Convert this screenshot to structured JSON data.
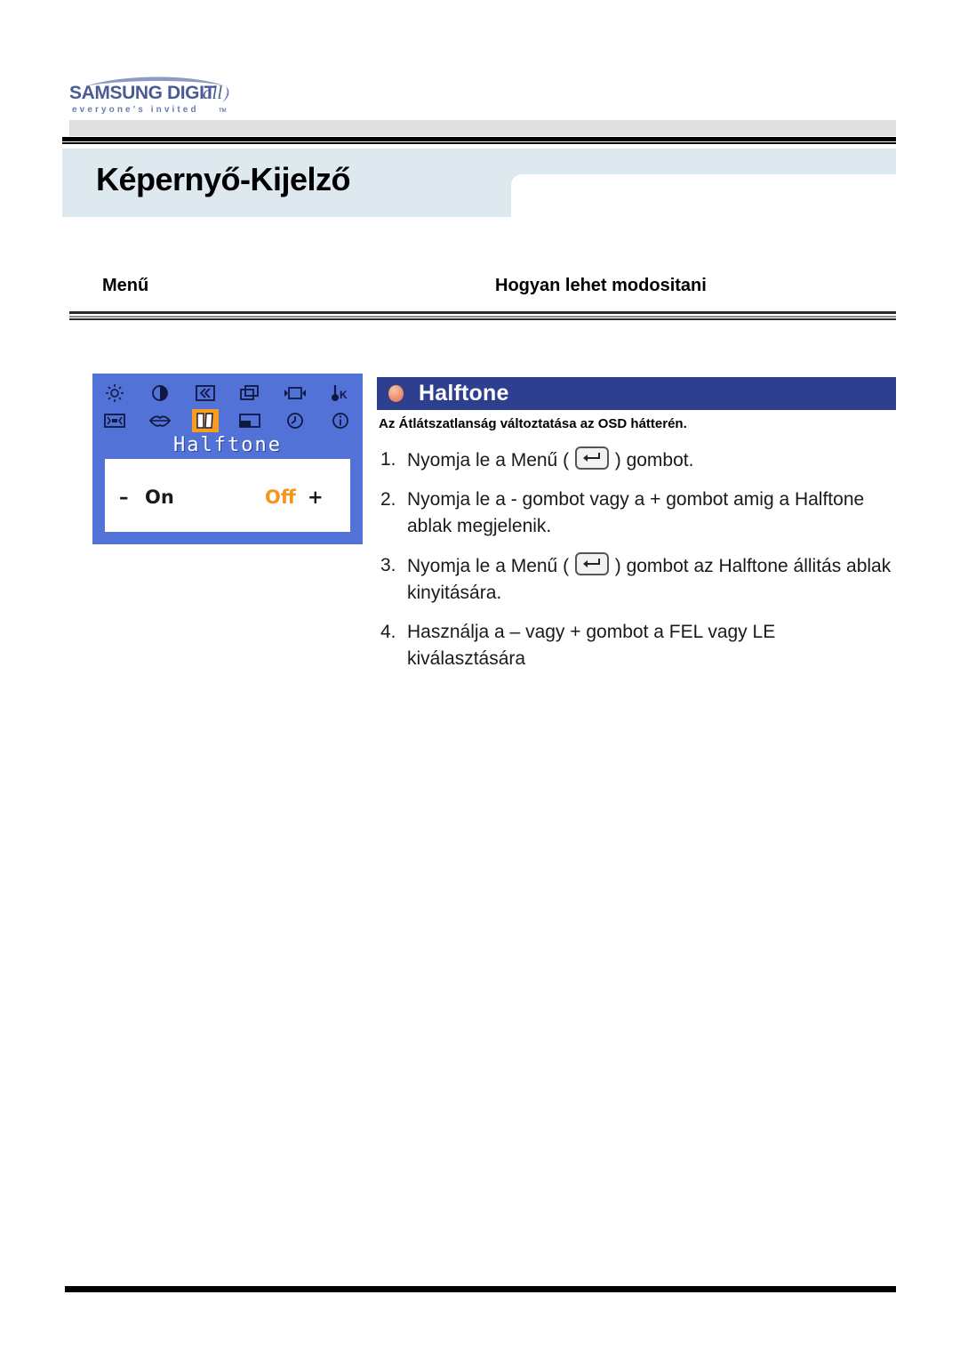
{
  "brand": {
    "logo_main": "SAMSUNG DIGITall",
    "logo_tagline": "everyone's invited",
    "logo_tagline_tm": "TM",
    "logo_color": "#5a6ea8"
  },
  "header": {
    "page_title": "Képernyő-Kijelző",
    "band_color": "#dee8ef"
  },
  "columns": {
    "menu_label": "Menű",
    "how_label": "Hogyan lehet modositani"
  },
  "osd": {
    "background_color": "#5272d8",
    "highlight_color": "#f79e1c",
    "title": "Halftone",
    "row": {
      "minus": "–",
      "on": "On",
      "off": "Off",
      "plus": "+"
    },
    "icons_row1": [
      {
        "name": "brightness-icon",
        "label": "Brightness"
      },
      {
        "name": "contrast-icon",
        "label": "Contrast"
      },
      {
        "name": "image-lock-icon",
        "label": "Image Lock"
      },
      {
        "name": "coarse-icon",
        "label": "Coarse"
      },
      {
        "name": "position-icon",
        "label": "Position"
      },
      {
        "name": "color-temperature-icon",
        "label": "Color Temperature K"
      }
    ],
    "icons_row2": [
      {
        "name": "image-size-icon",
        "label": "Image Size"
      },
      {
        "name": "language-icon",
        "label": "Language"
      },
      {
        "name": "halftone-icon",
        "label": "Halftone",
        "selected": true
      },
      {
        "name": "osd-position-icon",
        "label": "OSD Position"
      },
      {
        "name": "display-time-icon",
        "label": "Display Time"
      },
      {
        "name": "information-icon",
        "label": "Information"
      }
    ]
  },
  "panel": {
    "banner_color": "#2e3f8f",
    "bullet_icon": "orange-ball-bullet-icon",
    "title": "Halftone",
    "subtitle": "Az Átlátszatlanság változtatása az OSD hátterén.",
    "steps": [
      {
        "num": "1.",
        "pre": "Nyomja le a Menű  ( ",
        "key": "enter-key-icon",
        "post": " ) gombot."
      },
      {
        "num": "2.",
        "pre": "Nyomja le a - gombot vagy a + gombot amig a Halftone ablak megjelenik.",
        "key": null,
        "post": ""
      },
      {
        "num": "3.",
        "pre": "Nyomja le a Menű ( ",
        "key": "enter-key-icon",
        "post": " ) gombot az Halftone állitás ablak kinyitására."
      },
      {
        "num": "4.",
        "pre": "Használja a – vagy + gombot a FEL vagy LE kiválasztására",
        "key": null,
        "post": ""
      }
    ]
  }
}
